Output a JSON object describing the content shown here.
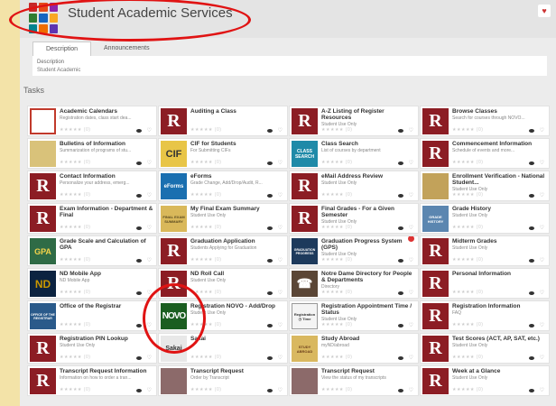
{
  "header": {
    "title": "Student Academic Services",
    "favorite_glyph": "♥",
    "logo_colors": [
      "#c62828",
      "#e64a19",
      "#8e24aa",
      "#2e7d32",
      "#1565c0",
      "#f9a825",
      "#00838f",
      "#ef6c00",
      "#5e35b1"
    ]
  },
  "tabs": [
    {
      "label": "Description"
    },
    {
      "label": "Announcements"
    }
  ],
  "description": {
    "label": "Description",
    "text": "Student Academic"
  },
  "tasks_title": "Tasks",
  "rating_text": "★★★★★ (0)",
  "fav_glyph": "♡",
  "tiles": [
    {
      "name": "Academic Calendars",
      "desc": "Registration dates, class start dea...",
      "icon": "calendar-icon"
    },
    {
      "name": "Auditing a Class",
      "desc": "",
      "icon": "r"
    },
    {
      "name": "A-Z Listing of Register Resources",
      "desc": "Student Use Only",
      "icon": "r"
    },
    {
      "name": "Browse Classes",
      "desc": "Search for courses through NOVO...",
      "icon": "r"
    },
    {
      "name": "Bulletins of Information",
      "desc": "Summarization of programs of stu...",
      "icon": "bulletin-icon"
    },
    {
      "name": "CIF for Students",
      "desc": "For Submitting CIFs",
      "icon": "cif-icon",
      "text": "CIF"
    },
    {
      "name": "Class Search",
      "desc": "List of courses by department",
      "icon": "class-search-icon",
      "text": "CLASS SEARCH"
    },
    {
      "name": "Commencement Information",
      "desc": "Schedule of events and more...",
      "icon": "r"
    },
    {
      "name": "Contact Information",
      "desc": "Personalize your address, emerg...",
      "icon": "r"
    },
    {
      "name": "eForms",
      "desc": "Grade Change, Add/Drop/Audit, R...",
      "icon": "eforms-icon",
      "text": "eForms"
    },
    {
      "name": "eMail Address Review",
      "desc": "Student Use Only",
      "icon": "r"
    },
    {
      "name": "Enrollment Verification - National Student...",
      "desc": "Student Use Only",
      "icon": "enrollment-icon"
    },
    {
      "name": "Exam Information - Department & Final",
      "desc": "",
      "icon": "r"
    },
    {
      "name": "My Final Exam Summary",
      "desc": "Student Use Only",
      "icon": "final-exam-icon",
      "text": "FINAL EXAM SUMMARY"
    },
    {
      "name": "Final Grades - For a Given Semester",
      "desc": "Student Use Only",
      "icon": "r"
    },
    {
      "name": "Grade History",
      "desc": "Student Use Only",
      "icon": "grade-history-icon",
      "text": "GRADE HISTORY"
    },
    {
      "name": "Grade Scale and Calculation of GPA",
      "desc": "",
      "icon": "gpa-icon",
      "text": "GPA"
    },
    {
      "name": "Graduation Application",
      "desc": "Students Applying for Graduation",
      "icon": "r"
    },
    {
      "name": "Graduation Progress System (GPS)",
      "desc": "Student Use Only",
      "icon": "graduation-icon",
      "text": "GRADUATION PROGRESS",
      "badge": true
    },
    {
      "name": "Midterm Grades",
      "desc": "Student Use Only",
      "icon": "r"
    },
    {
      "name": "ND Mobile App",
      "desc": "ND Mobile App",
      "icon": "nd-icon",
      "text": "ND"
    },
    {
      "name": "ND Roll Call",
      "desc": "Student Use Only",
      "icon": "r"
    },
    {
      "name": "Notre Dame Directory for People & Departments",
      "desc": "Directory",
      "icon": "phone-icon",
      "text": "☎"
    },
    {
      "name": "Personal Information",
      "desc": "",
      "icon": "r"
    },
    {
      "name": "Office of the Registrar",
      "desc": "",
      "icon": "registrar-icon",
      "text": "OFFICE OF THE REGISTRAR"
    },
    {
      "name": "Registration NOVO - Add/Drop",
      "desc": "Student Use Only",
      "icon": "novo-icon",
      "text": "NOVO"
    },
    {
      "name": "Registration Appointment Time / Status",
      "desc": "Student Use Only",
      "icon": "registration-time-icon",
      "text": "Registration ◷ Time"
    },
    {
      "name": "Registration Information",
      "desc": "FAQ",
      "icon": "r"
    },
    {
      "name": "Registration PIN Lookup",
      "desc": "Student Use Only",
      "icon": "r"
    },
    {
      "name": "Sakai",
      "desc": "",
      "icon": "sakai-icon",
      "text": "Sakai"
    },
    {
      "name": "Study Abroad",
      "desc": "myND/abroad",
      "icon": "study-abroad-icon",
      "text": "STUDY ABROAD"
    },
    {
      "name": "Test Scores (ACT, AP, SAT, etc.)",
      "desc": "Student Use Only",
      "icon": "r"
    },
    {
      "name": "Transcript Request Information",
      "desc": "Information on how to order a tran...",
      "icon": "r"
    },
    {
      "name": "Transcript Request",
      "desc": "Order by Transcript",
      "icon": "transcript-icon"
    },
    {
      "name": "Transcript Request",
      "desc": "View the status of my transcripts",
      "icon": "transcript-icon"
    },
    {
      "name": "Week at a Glance",
      "desc": "Student Use Only",
      "icon": "r"
    }
  ]
}
